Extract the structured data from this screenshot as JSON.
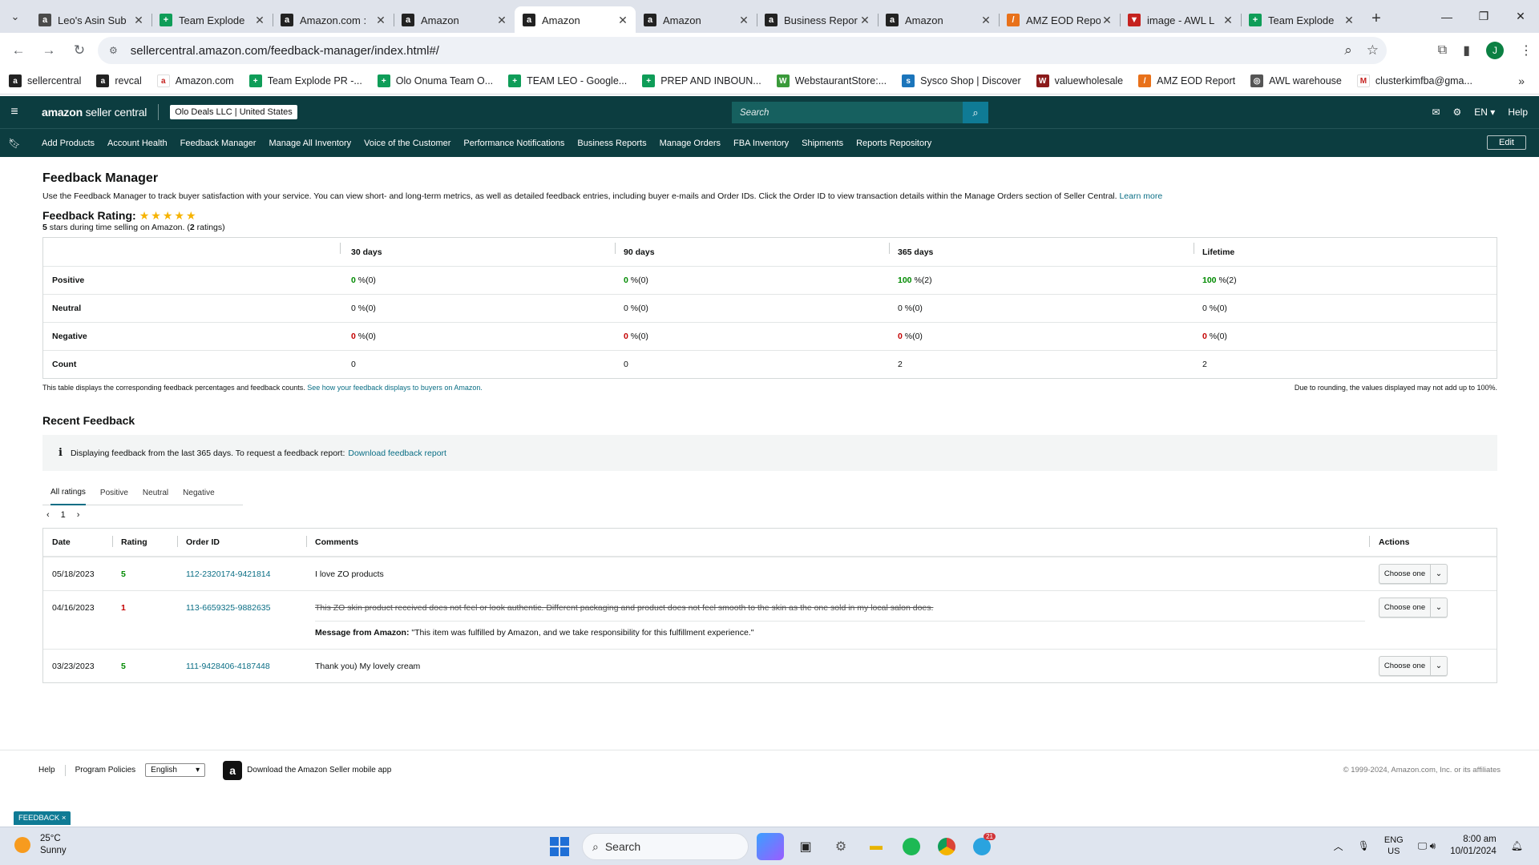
{
  "browser": {
    "tabs": [
      {
        "title": "Leo's Asin Sub",
        "fav_color": "#4a4a4a",
        "fav_glyph": "a"
      },
      {
        "title": "Team Explode",
        "fav_color": "#0f9d58",
        "fav_glyph": "+"
      },
      {
        "title": "Amazon.com :",
        "fav_color": "#222222",
        "fav_glyph": "a"
      },
      {
        "title": "Amazon",
        "fav_color": "#222222",
        "fav_glyph": "a"
      },
      {
        "title": "Amazon",
        "fav_color": "#222222",
        "fav_glyph": "a",
        "active": true
      },
      {
        "title": "Amazon",
        "fav_color": "#222222",
        "fav_glyph": "a"
      },
      {
        "title": "Business Repor",
        "fav_color": "#222222",
        "fav_glyph": "a"
      },
      {
        "title": "Amazon",
        "fav_color": "#222222",
        "fav_glyph": "a"
      },
      {
        "title": "AMZ EOD Repo",
        "fav_color": "#e8711a",
        "fav_glyph": "/"
      },
      {
        "title": "image - AWL L",
        "fav_color": "#c5221f",
        "fav_glyph": "▼"
      },
      {
        "title": "Team Explode",
        "fav_color": "#0f9d58",
        "fav_glyph": "+"
      }
    ],
    "url": "sellercentral.amazon.com/feedback-manager/index.html#/",
    "bookmarks": [
      {
        "label": "sellercentral",
        "color": "#222222",
        "glyph": "a"
      },
      {
        "label": "revcal",
        "color": "#222222",
        "glyph": "a"
      },
      {
        "label": "Amazon.com",
        "color": "#ffffff",
        "glyph": "a"
      },
      {
        "label": "Team Explode PR -...",
        "color": "#0f9d58",
        "glyph": "+"
      },
      {
        "label": "Olo Onuma Team O...",
        "color": "#0f9d58",
        "glyph": "+"
      },
      {
        "label": "TEAM LEO - Google...",
        "color": "#0f9d58",
        "glyph": "+"
      },
      {
        "label": "PREP AND INBOUN...",
        "color": "#0f9d58",
        "glyph": "+"
      },
      {
        "label": "WebstaurantStore:...",
        "color": "#3a9a3a",
        "glyph": "W"
      },
      {
        "label": "Sysco Shop | Discover",
        "color": "#1b75bb",
        "glyph": "s"
      },
      {
        "label": "valuewholesale",
        "color": "#8b1a1a",
        "glyph": "W"
      },
      {
        "label": "AMZ EOD Report",
        "color": "#e8711a",
        "glyph": "/"
      },
      {
        "label": "AWL warehouse",
        "color": "#555555",
        "glyph": "◎"
      },
      {
        "label": "clusterkimfba@gma...",
        "color": "#ffffff",
        "glyph": "M"
      }
    ],
    "profile_initial": "J"
  },
  "seller_central": {
    "logo_bold": "amazon",
    "logo_rest": " seller central",
    "store": "Olo Deals LLC | United States",
    "search_placeholder": "Search",
    "lang": "EN",
    "help": "Help",
    "nav": [
      "Add Products",
      "Account Health",
      "Feedback Manager",
      "Manage All Inventory",
      "Voice of the Customer",
      "Performance Notifications",
      "Business Reports",
      "Manage Orders",
      "FBA Inventory",
      "Shipments",
      "Reports Repository"
    ],
    "edit": "Edit"
  },
  "page": {
    "title": "Feedback Manager",
    "description": "Use the Feedback Manager to track buyer satisfaction with your service. You can view short- and long-term metrics, as well as detailed feedback entries, including buyer e-mails and Order IDs. Click the Order ID to view transaction details within the Manage Orders section of Seller Central.",
    "learn_more": "Learn more",
    "rating_title": "Feedback Rating:",
    "stars": 5,
    "rating_sub_pre": "5",
    "rating_sub_mid": " stars during time selling on Amazon. (",
    "rating_sub_count": "2",
    "rating_sub_post": " ratings)"
  },
  "feedback_table": {
    "headers": [
      "",
      "30 days",
      "90 days",
      "365 days",
      "Lifetime"
    ],
    "rows": [
      {
        "label": "Positive",
        "cells": [
          {
            "n": "0",
            "s": " %(0)"
          },
          {
            "n": "0",
            "s": " %(0)"
          },
          {
            "n": "100",
            "s": " %(2)"
          },
          {
            "n": "100",
            "s": " %(2)"
          }
        ],
        "kind": "pos"
      },
      {
        "label": "Neutral",
        "cells": [
          {
            "n": "0",
            "s": " %(0)"
          },
          {
            "n": "0",
            "s": " %(0)"
          },
          {
            "n": "0",
            "s": " %(0)"
          },
          {
            "n": "0",
            "s": " %(0)"
          }
        ],
        "kind": "neu"
      },
      {
        "label": "Negative",
        "cells": [
          {
            "n": "0",
            "s": " %(0)"
          },
          {
            "n": "0",
            "s": " %(0)"
          },
          {
            "n": "0",
            "s": " %(0)"
          },
          {
            "n": "0",
            "s": " %(0)"
          }
        ],
        "kind": "neg"
      },
      {
        "label": "Count",
        "cells": [
          {
            "n": "0",
            "s": ""
          },
          {
            "n": "0",
            "s": ""
          },
          {
            "n": "2",
            "s": ""
          },
          {
            "n": "2",
            "s": ""
          }
        ],
        "kind": "count"
      }
    ],
    "note_left": "This table displays the corresponding feedback percentages and feedback counts.",
    "note_link": "See how your feedback displays to buyers on Amazon.",
    "note_right": "Due to rounding, the values displayed may not add up to 100%."
  },
  "recent": {
    "title": "Recent Feedback",
    "info": "Displaying feedback from the last 365 days. To request a feedback report:",
    "info_link": "Download feedback report",
    "tabs": [
      "All ratings",
      "Positive",
      "Neutral",
      "Negative"
    ],
    "page": "1",
    "headers": {
      "date": "Date",
      "rating": "Rating",
      "order": "Order ID",
      "comments": "Comments",
      "actions": "Actions"
    },
    "rows": [
      {
        "date": "05/18/2023",
        "rating": "5",
        "order": "112-2320174-9421814",
        "comment": "I love ZO products",
        "struck": false
      },
      {
        "date": "04/16/2023",
        "rating": "1",
        "order": "113-6659325-9882635",
        "comment": "This ZO skin product received does not feel or look authentic. Different packaging and product does not feel smooth to the skin as the one sold in my local salon does.",
        "struck": true,
        "amazon_label": "Message from Amazon:",
        "amazon_msg": " \"This item was fulfilled by Amazon, and we take responsibility for this fulfillment experience.\""
      },
      {
        "date": "03/23/2023",
        "rating": "5",
        "order": "111-9428406-4187448",
        "comment": "Thank you) My lovely cream",
        "struck": false
      }
    ],
    "action_label": "Choose one"
  },
  "footer": {
    "help": "Help",
    "policies": "Program Policies",
    "language": "English",
    "app": "Download the Amazon Seller mobile app",
    "copyright": "© 1999-2024, Amazon.com, Inc. or its affiliates"
  },
  "feedback_tag": "FEEDBACK ×",
  "taskbar": {
    "temp": "25°C",
    "weather": "Sunny",
    "search": "Search",
    "lang1": "ENG",
    "lang2": "US",
    "time": "8:00 am",
    "date": "10/01/2024",
    "telegram_badge": "21"
  }
}
